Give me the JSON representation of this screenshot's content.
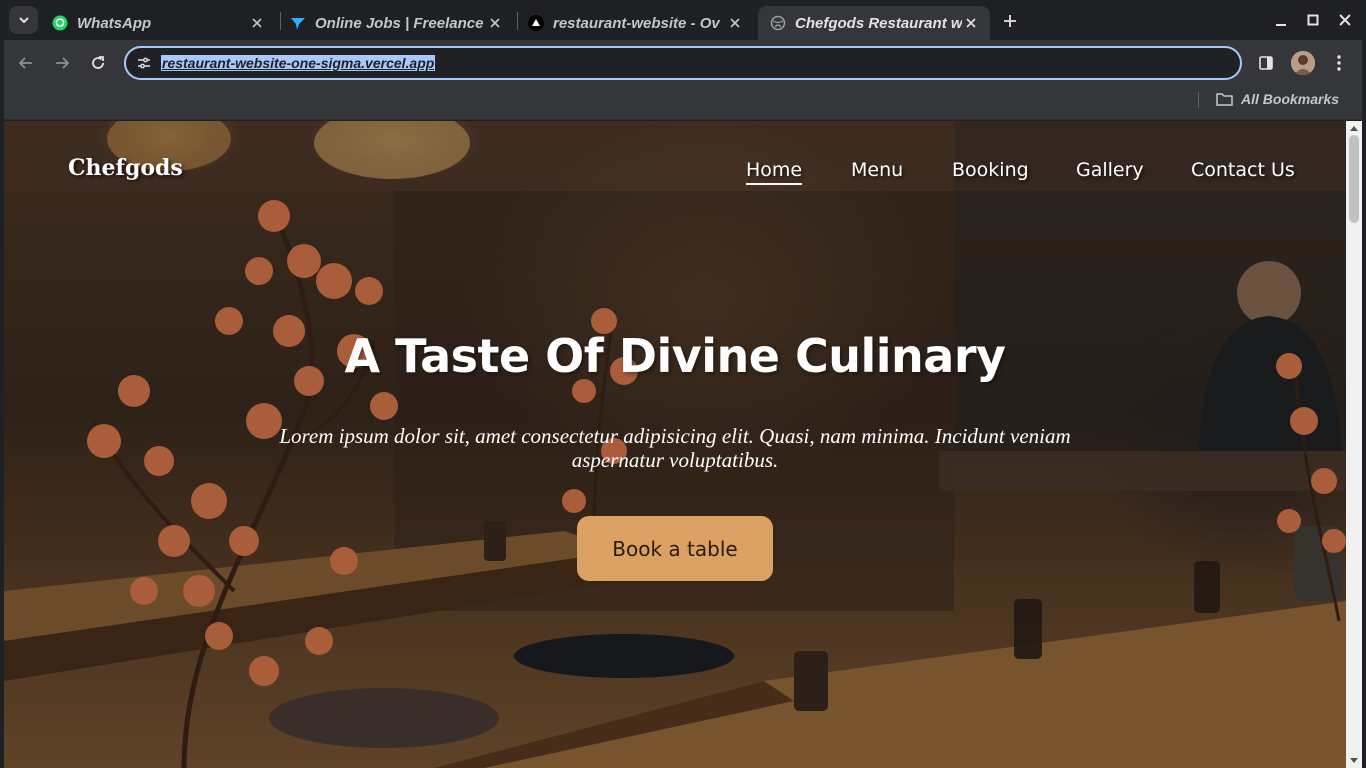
{
  "browser": {
    "tabs": [
      {
        "title": "WhatsApp",
        "icon": "whatsapp-icon",
        "active": false
      },
      {
        "title": "Online Jobs | Freelance",
        "icon": "freelancer-icon",
        "active": false
      },
      {
        "title": "restaurant-website - Ov",
        "icon": "vercel-icon",
        "active": false
      },
      {
        "title": "Chefgods Restaurant w",
        "icon": "globe-icon",
        "active": true
      }
    ],
    "url": "restaurant-website-one-sigma.vercel.app",
    "bookmarks": {
      "all_label": "All Bookmarks"
    },
    "colors": {
      "frame": "#1f2023",
      "toolbar": "#35363a",
      "omnibox_focus": "#a8c7fa"
    }
  },
  "site": {
    "brand": "Chefgods",
    "nav": [
      {
        "label": "Home",
        "active": true
      },
      {
        "label": "Menu",
        "active": false
      },
      {
        "label": "Booking",
        "active": false
      },
      {
        "label": "Gallery",
        "active": false
      },
      {
        "label": "Contact Us",
        "active": false
      }
    ],
    "hero": {
      "title": "A Taste Of Divine Culinary",
      "subtitle": "Lorem ipsum dolor sit, amet consectetur adipisicing elit. Quasi, nam minima. Incidunt veniam aspernatur voluptatibus.",
      "cta_label": "Book a table"
    },
    "colors": {
      "cta": "#dba162",
      "cta_text": "#2a1b10"
    }
  }
}
